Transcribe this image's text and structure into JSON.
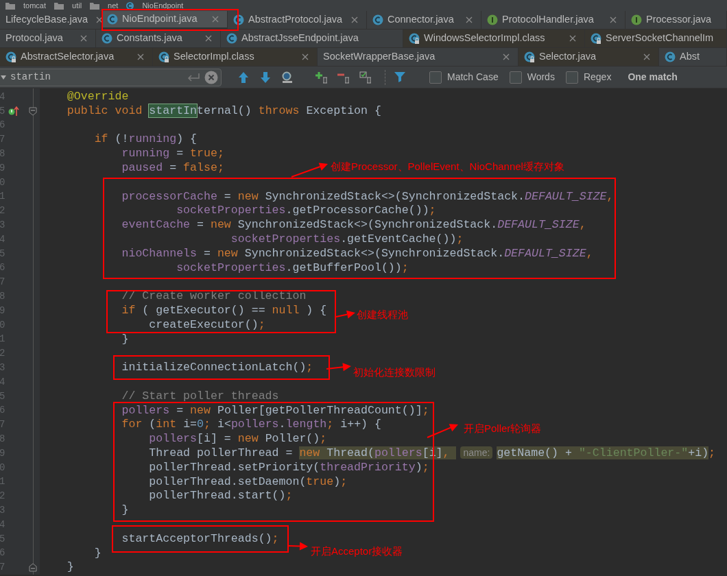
{
  "breadcrumbs": [
    {
      "label": "tomcat",
      "kind": "folder"
    },
    {
      "label": "util",
      "kind": "folder"
    },
    {
      "label": "net",
      "kind": "folder"
    },
    {
      "label": "NioEndpoint",
      "kind": "class"
    }
  ],
  "tab_rows": [
    [
      {
        "label": "LifecycleBase.java",
        "locked": false,
        "selected": false,
        "marked": false,
        "closable": true
      },
      {
        "label": "NioEndpoint.java",
        "kind": "class",
        "locked": false,
        "selected": true,
        "marked": true,
        "closable": true
      },
      {
        "label": "AbstractProtocol.java",
        "kind": "class",
        "locked": false,
        "selected": false,
        "marked": false,
        "closable": true
      },
      {
        "label": "Connector.java",
        "kind": "class",
        "locked": false,
        "selected": false,
        "marked": false,
        "closable": true
      },
      {
        "label": "ProtocolHandler.java",
        "kind": "interface",
        "locked": false,
        "selected": false,
        "marked": false,
        "closable": true
      },
      {
        "label": "Processor.java",
        "kind": "interface",
        "locked": false,
        "selected": false,
        "marked": false,
        "closable": false
      }
    ],
    [
      {
        "label": "Protocol.java",
        "locked": false,
        "selected": false,
        "marked": false,
        "closable": true
      },
      {
        "label": "Constants.java",
        "kind": "class",
        "locked": false,
        "selected": false,
        "marked": false,
        "closable": true
      },
      {
        "label": "AbstractJsseEndpoint.java",
        "kind": "class",
        "locked": false,
        "selected": false,
        "marked": false,
        "closable": false
      },
      {
        "label": "WindowsSelectorImpl.class",
        "kind": "class",
        "locked": true,
        "selected": false,
        "marked": false,
        "closable": true
      },
      {
        "label": "ServerSocketChannelIm",
        "kind": "class",
        "locked": true,
        "selected": false,
        "marked": false,
        "closable": false
      }
    ],
    [
      {
        "label": "AbstractSelector.java",
        "kind": "class",
        "locked": true,
        "selected": false,
        "marked": false,
        "closable": true
      },
      {
        "label": "SelectorImpl.class",
        "kind": "class",
        "locked": true,
        "selected": false,
        "marked": false,
        "closable": true
      },
      {
        "label": "SocketWrapperBase.java",
        "locked": false,
        "selected": false,
        "marked": false,
        "closable": true
      },
      {
        "label": "Selector.java",
        "kind": "class",
        "locked": true,
        "selected": false,
        "marked": false,
        "closable": true
      },
      {
        "label": "Abst",
        "kind": "class",
        "locked": false,
        "selected": false,
        "marked": false,
        "closable": false
      }
    ]
  ],
  "search": {
    "value": "startin",
    "options": [
      {
        "label": "Match Case",
        "checked": false
      },
      {
        "label": "Words",
        "checked": false
      },
      {
        "label": "Regex",
        "checked": false
      }
    ],
    "result": "One match"
  },
  "code_lines": [
    {
      "number": "4",
      "tokens": [
        {
          "kind": "annotation",
          "text": "@Override"
        }
      ]
    },
    {
      "number": "5",
      "overrides": true,
      "fold_start": true,
      "tokens": [
        {
          "kind": "keyword",
          "text": "public void "
        },
        {
          "kind": "plain",
          "text": "startIn",
          "match": true
        },
        {
          "kind": "plain",
          "text": "ternal() "
        },
        {
          "kind": "keyword",
          "text": "throws "
        },
        {
          "kind": "plain",
          "text": "Exception {"
        }
      ]
    },
    {
      "number": "6"
    },
    {
      "number": "7",
      "tokens": [
        {
          "kind": "keyword",
          "text": "if "
        },
        {
          "kind": "plain",
          "text": "(!"
        },
        {
          "kind": "field",
          "text": "running"
        },
        {
          "kind": "plain",
          "text": ") {"
        }
      ]
    },
    {
      "number": "8",
      "tokens": [
        {
          "kind": "field",
          "text": "running"
        },
        {
          "kind": "plain",
          "text": " = "
        },
        {
          "kind": "keyword",
          "text": "true;"
        }
      ]
    },
    {
      "number": "9",
      "tokens": [
        {
          "kind": "field",
          "text": "paused"
        },
        {
          "kind": "plain",
          "text": " = "
        },
        {
          "kind": "keyword",
          "text": "false;"
        }
      ]
    },
    {
      "number": "0"
    },
    {
      "number": "1",
      "tokens": [
        {
          "kind": "field",
          "text": "processorCache"
        },
        {
          "kind": "plain",
          "text": " = "
        },
        {
          "kind": "keyword",
          "text": "new "
        },
        {
          "kind": "plain",
          "text": "SynchronizedStack<>(SynchronizedStack."
        },
        {
          "kind": "constant",
          "text": "DEFAULT_SIZE"
        },
        {
          "kind": "keyword",
          "text": ","
        }
      ]
    },
    {
      "number": "2",
      "tokens": [
        {
          "kind": "field",
          "text": "socketProperties"
        },
        {
          "kind": "plain",
          "text": ".getProcessorCache())"
        },
        {
          "kind": "keyword",
          "text": ";"
        }
      ]
    },
    {
      "number": "3",
      "tokens": [
        {
          "kind": "field",
          "text": "eventCache"
        },
        {
          "kind": "plain",
          "text": " = "
        },
        {
          "kind": "keyword",
          "text": "new "
        },
        {
          "kind": "plain",
          "text": "SynchronizedStack<>(SynchronizedStack."
        },
        {
          "kind": "constant",
          "text": "DEFAULT_SIZE"
        },
        {
          "kind": "keyword",
          "text": ","
        }
      ]
    },
    {
      "number": "4",
      "tokens": [
        {
          "kind": "field",
          "text": "socketProperties"
        },
        {
          "kind": "plain",
          "text": ".getEventCache())"
        },
        {
          "kind": "keyword",
          "text": ";"
        }
      ]
    },
    {
      "number": "5",
      "tokens": [
        {
          "kind": "field",
          "text": "nioChannels"
        },
        {
          "kind": "plain",
          "text": " = "
        },
        {
          "kind": "keyword",
          "text": "new "
        },
        {
          "kind": "plain",
          "text": "SynchronizedStack<>(SynchronizedStack."
        },
        {
          "kind": "constant",
          "text": "DEFAULT_SIZE"
        },
        {
          "kind": "keyword",
          "text": ","
        }
      ]
    },
    {
      "number": "6",
      "tokens": [
        {
          "kind": "field",
          "text": "socketProperties"
        },
        {
          "kind": "plain",
          "text": ".getBufferPool())"
        },
        {
          "kind": "keyword",
          "text": ";"
        }
      ]
    },
    {
      "number": "7"
    },
    {
      "number": "8",
      "tokens": [
        {
          "kind": "comment",
          "text": "// Create worker collection"
        }
      ]
    },
    {
      "number": "9",
      "tokens": [
        {
          "kind": "keyword",
          "text": "if "
        },
        {
          "kind": "plain",
          "text": "( getExecutor() == "
        },
        {
          "kind": "keyword",
          "text": "null"
        },
        {
          "kind": "plain",
          "text": " ) {"
        }
      ]
    },
    {
      "number": "0",
      "tokens": [
        {
          "kind": "plain",
          "text": "createExecutor()"
        },
        {
          "kind": "keyword",
          "text": ";"
        }
      ]
    },
    {
      "number": "1",
      "tokens": [
        {
          "kind": "plain",
          "text": "}"
        }
      ]
    },
    {
      "number": "2"
    },
    {
      "number": "3",
      "tokens": [
        {
          "kind": "plain",
          "text": "initializeConnectionLatch()"
        },
        {
          "kind": "keyword",
          "text": ";"
        }
      ]
    },
    {
      "number": "4"
    },
    {
      "number": "5",
      "tokens": [
        {
          "kind": "comment",
          "text": "// Start poller threads"
        }
      ]
    },
    {
      "number": "6",
      "tokens": [
        {
          "kind": "field",
          "text": "pollers"
        },
        {
          "kind": "plain",
          "text": " = "
        },
        {
          "kind": "keyword",
          "text": "new "
        },
        {
          "kind": "plain",
          "text": "Poller[getPollerThreadCount()]"
        },
        {
          "kind": "keyword",
          "text": ";"
        }
      ]
    },
    {
      "number": "7",
      "tokens": [
        {
          "kind": "keyword",
          "text": "for "
        },
        {
          "kind": "plain",
          "text": "("
        },
        {
          "kind": "keyword",
          "text": "int "
        },
        {
          "kind": "plain",
          "text": "i="
        },
        {
          "kind": "number",
          "text": "0"
        },
        {
          "kind": "keyword",
          "text": "; "
        },
        {
          "kind": "plain",
          "text": "i<"
        },
        {
          "kind": "field",
          "text": "pollers"
        },
        {
          "kind": "plain",
          "text": "."
        },
        {
          "kind": "field",
          "text": "length"
        },
        {
          "kind": "keyword",
          "text": "; "
        },
        {
          "kind": "plain",
          "text": "i++) {"
        }
      ]
    },
    {
      "number": "8",
      "tokens": [
        {
          "kind": "field",
          "text": "pollers"
        },
        {
          "kind": "plain",
          "text": "[i] = "
        },
        {
          "kind": "keyword",
          "text": "new "
        },
        {
          "kind": "plain",
          "text": "Poller()"
        },
        {
          "kind": "keyword",
          "text": ";"
        }
      ]
    },
    {
      "number": "9",
      "tokens": [
        {
          "kind": "plain",
          "text": "Thread pollerThread = "
        },
        {
          "kind": "keyword",
          "text": "new ",
          "highlighted": true
        },
        {
          "kind": "plain",
          "text": "Thread(",
          "highlighted": true
        },
        {
          "kind": "field",
          "text": "pollers",
          "highlighted": true
        },
        {
          "kind": "plain",
          "text": "[i]",
          "highlighted": true
        },
        {
          "kind": "keyword",
          "text": ", ",
          "highlighted": true
        },
        {
          "kind": "hint",
          "text": "name:",
          "highlighted": true
        },
        {
          "kind": "plain",
          "text": "getName() + ",
          "highlighted": true
        },
        {
          "kind": "string",
          "text": "\"-ClientPoller-\"",
          "highlighted": true
        },
        {
          "kind": "plain",
          "text": "+i)",
          "highlighted": true
        },
        {
          "kind": "keyword",
          "text": ";"
        }
      ]
    },
    {
      "number": "0",
      "tokens": [
        {
          "kind": "plain",
          "text": "pollerThread.setPriority("
        },
        {
          "kind": "field",
          "text": "threadPriority"
        },
        {
          "kind": "plain",
          "text": ")"
        },
        {
          "kind": "keyword",
          "text": ";"
        }
      ]
    },
    {
      "number": "1",
      "tokens": [
        {
          "kind": "plain",
          "text": "pollerThread.setDaemon("
        },
        {
          "kind": "keyword",
          "text": "true"
        },
        {
          "kind": "plain",
          "text": ")"
        },
        {
          "kind": "keyword",
          "text": ";"
        }
      ]
    },
    {
      "number": "2",
      "tokens": [
        {
          "kind": "plain",
          "text": "pollerThread.start()"
        },
        {
          "kind": "keyword",
          "text": ";"
        }
      ]
    },
    {
      "number": "3",
      "tokens": [
        {
          "kind": "plain",
          "text": "}"
        }
      ]
    },
    {
      "number": "4"
    },
    {
      "number": "5",
      "tokens": [
        {
          "kind": "plain",
          "text": "startAcceptorThreads()"
        },
        {
          "kind": "keyword",
          "text": ";"
        }
      ]
    },
    {
      "number": "6",
      "tokens": [
        {
          "kind": "plain",
          "text": "}"
        }
      ]
    },
    {
      "number": "7",
      "fold_end": true,
      "tokens": [
        {
          "kind": "plain",
          "text": "}"
        }
      ]
    }
  ],
  "annotations": [
    {
      "text": "创建Processor、PollelEvent、NioChannel缓存对象"
    },
    {
      "text": "创建线程池"
    },
    {
      "text": "初始化连接数限制"
    },
    {
      "text": "开启Poller轮询器"
    },
    {
      "text": "开启Acceptor接收器"
    }
  ]
}
